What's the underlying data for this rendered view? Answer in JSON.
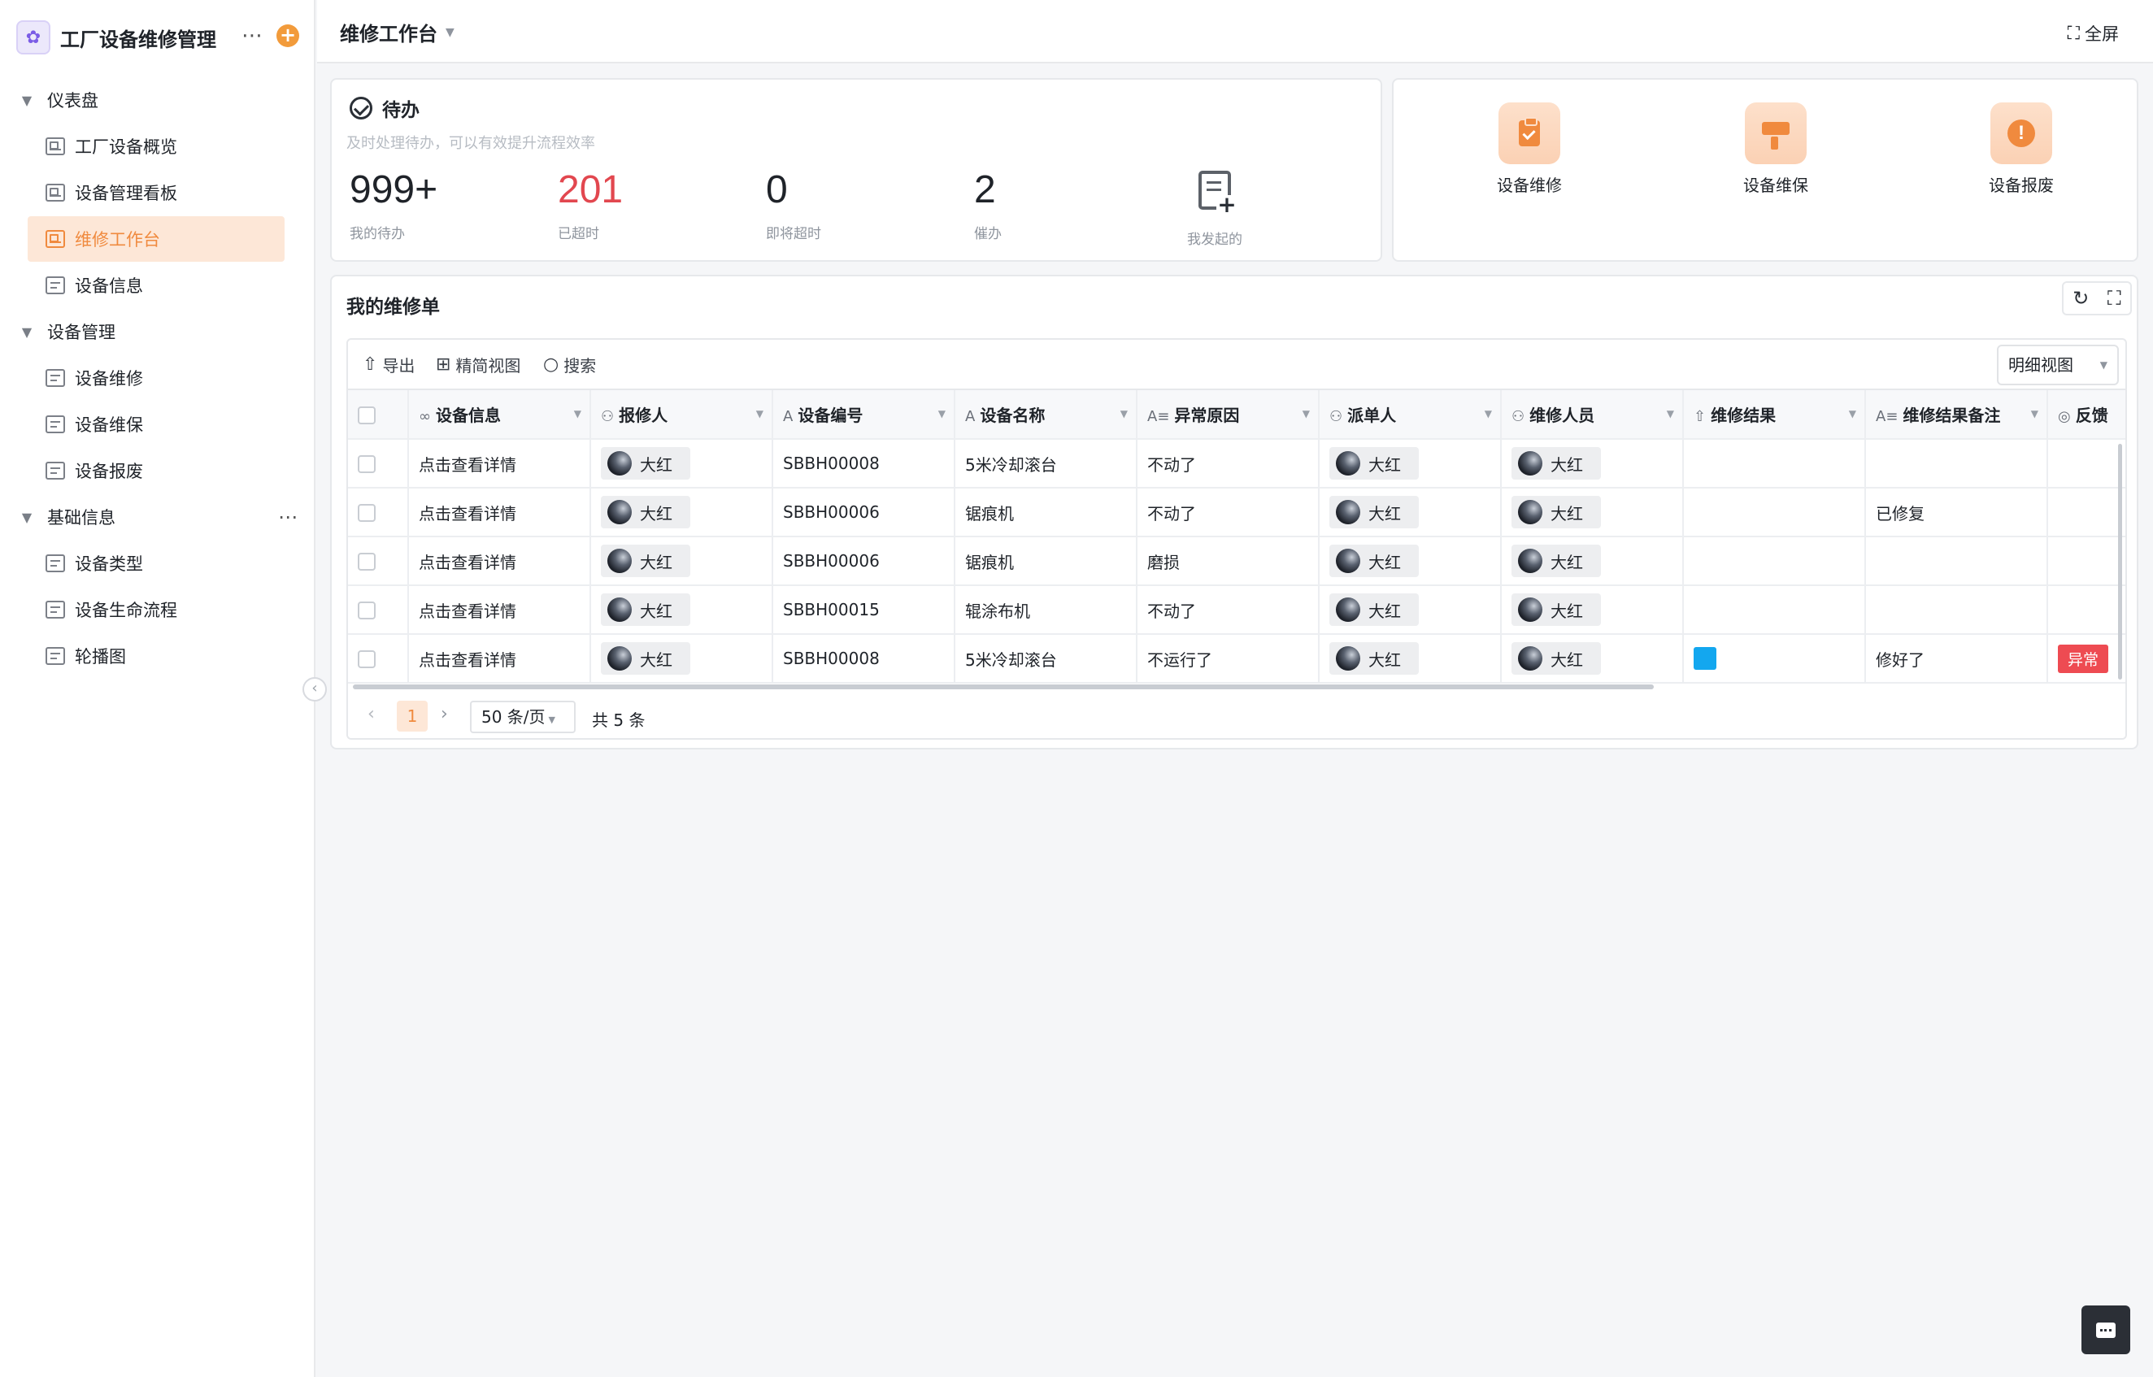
{
  "app": {
    "title": "工厂设备维修管理",
    "more_icon": "more-icon",
    "add_icon": "plus-icon"
  },
  "sidebar": {
    "groups": [
      {
        "label": "仪表盘",
        "items": [
          {
            "label": "工厂设备概览",
            "icon": "dashboard-icon"
          },
          {
            "label": "设备管理看板",
            "icon": "dashboard-icon"
          },
          {
            "label": "维修工作台",
            "icon": "dashboard-icon",
            "active": true
          },
          {
            "label": "设备信息",
            "icon": "doc-icon"
          }
        ]
      },
      {
        "label": "设备管理",
        "items": [
          {
            "label": "设备维修",
            "icon": "doc-icon"
          },
          {
            "label": "设备维保",
            "icon": "doc-icon"
          },
          {
            "label": "设备报废",
            "icon": "doc-icon"
          }
        ]
      },
      {
        "label": "基础信息",
        "items": [
          {
            "label": "设备类型",
            "icon": "doc-icon"
          },
          {
            "label": "设备生命流程",
            "icon": "doc-icon"
          },
          {
            "label": "轮播图",
            "icon": "doc-icon"
          }
        ]
      }
    ]
  },
  "topbar": {
    "title": "维修工作台",
    "fullscreen": "全屏"
  },
  "todo": {
    "title": "待办",
    "subtitle": "及时处理待办，可以有效提升流程效率",
    "stats": [
      {
        "value": "999+",
        "label": "我的待办"
      },
      {
        "value": "201",
        "label": "已超时"
      },
      {
        "value": "0",
        "label": "即将超时"
      },
      {
        "value": "2",
        "label": "催办"
      }
    ],
    "started_label": "我发起的"
  },
  "quick_actions": [
    {
      "label": "设备维修",
      "icon": "clipboard-check-icon"
    },
    {
      "label": "设备维保",
      "icon": "paint-roller-icon"
    },
    {
      "label": "设备报废",
      "icon": "warning-icon"
    }
  ],
  "orders": {
    "title": "我的维修单",
    "toolbar": {
      "export": "导出",
      "simple_view": "精简视图",
      "search": "搜索",
      "view_select": "明细视图"
    },
    "columns": [
      {
        "label": "设备信息",
        "icon": "∞"
      },
      {
        "label": "报修人",
        "icon": "⚇"
      },
      {
        "label": "设备编号",
        "icon": "A"
      },
      {
        "label": "设备名称",
        "icon": "A"
      },
      {
        "label": "异常原因",
        "icon": "A≡"
      },
      {
        "label": "派单人",
        "icon": "⚇"
      },
      {
        "label": "维修人员",
        "icon": "⚇"
      },
      {
        "label": "维修结果",
        "icon": "⇧"
      },
      {
        "label": "维修结果备注",
        "icon": "A≡"
      },
      {
        "label": "反馈",
        "icon": "◎"
      }
    ],
    "rows": [
      {
        "info": "点击查看详情",
        "reporter": "大红",
        "code": "SBBH00008",
        "name": "5米冷却滚台",
        "reason": "不动了",
        "dispatcher": "大红",
        "repairer": "大红",
        "result": "",
        "note": "",
        "feedback": ""
      },
      {
        "info": "点击查看详情",
        "reporter": "大红",
        "code": "SBBH00006",
        "name": "锯痕机",
        "reason": "不动了",
        "dispatcher": "大红",
        "repairer": "大红",
        "result": "",
        "note": "已修复",
        "feedback": ""
      },
      {
        "info": "点击查看详情",
        "reporter": "大红",
        "code": "SBBH00006",
        "name": "锯痕机",
        "reason": "磨损",
        "dispatcher": "大红",
        "repairer": "大红",
        "result": "",
        "note": "",
        "feedback": ""
      },
      {
        "info": "点击查看详情",
        "reporter": "大红",
        "code": "SBBH00015",
        "name": "辊涂布机",
        "reason": "不动了",
        "dispatcher": "大红",
        "repairer": "大红",
        "result": "",
        "note": "",
        "feedback": ""
      },
      {
        "info": "点击查看详情",
        "reporter": "大红",
        "code": "SBBH00008",
        "name": "5米冷却滚台",
        "reason": "不运行了",
        "dispatcher": "大红",
        "repairer": "大红",
        "result": "blue-square",
        "note": "修好了",
        "feedback": "异常"
      }
    ],
    "pager": {
      "current_page": "1",
      "page_size": "50 条/页",
      "total": "共 5 条"
    }
  },
  "colors": {
    "accent": "#f08a3e",
    "danger": "#e2474f",
    "result_blue": "#13a7ef"
  }
}
